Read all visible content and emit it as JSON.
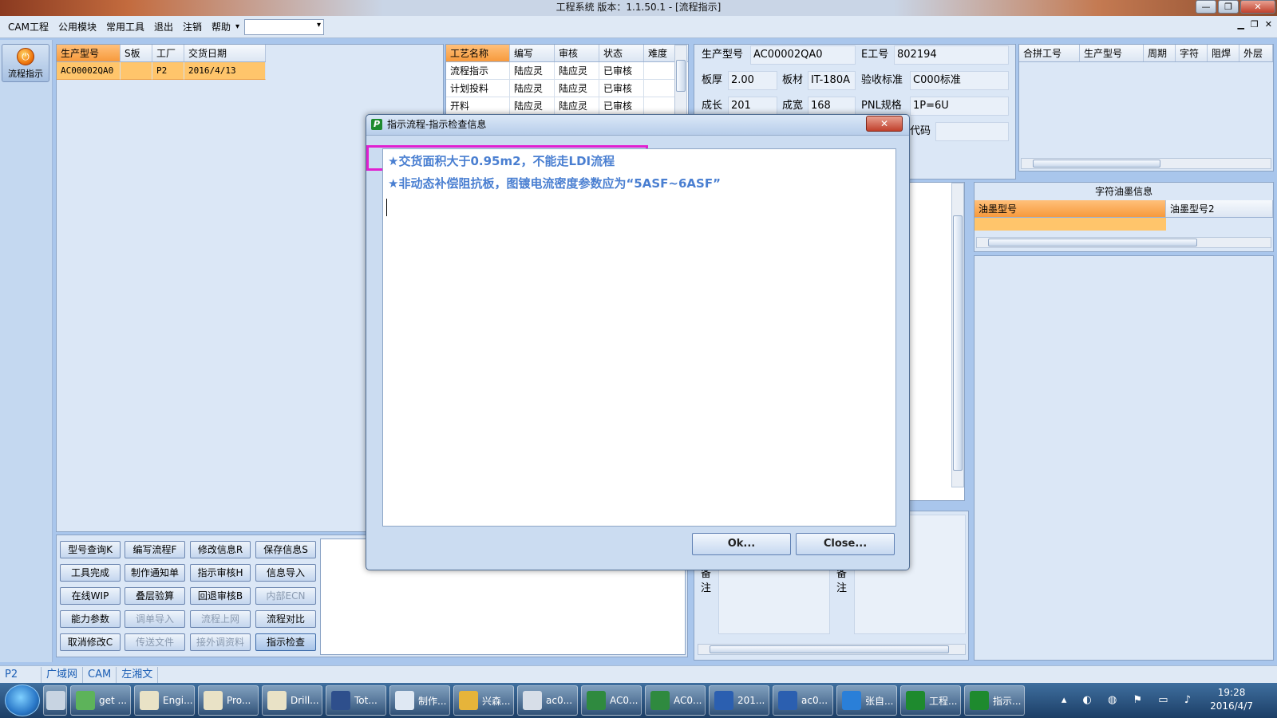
{
  "window": {
    "title": "工程系统    版本：1.1.50.1 - [流程指示]",
    "minimize": "—",
    "maximize": "❐",
    "close": "✕"
  },
  "menu": {
    "items": [
      "CAM工程",
      "公用模块",
      "常用工具",
      "退出",
      "注销",
      "帮助"
    ],
    "combo_value": ""
  },
  "launcher": {
    "label": "流程指示"
  },
  "model_grid": {
    "headers": [
      "生产型号",
      "S板",
      "工厂",
      "交货日期"
    ],
    "rows": [
      [
        "AC00002QA0",
        "",
        "P2",
        "2016/4/13"
      ]
    ]
  },
  "process_grid": {
    "headers": [
      "工艺名称",
      "编写",
      "审核",
      "状态",
      "难度"
    ],
    "rows": [
      [
        "流程指示",
        "陆应灵",
        "陆应灵",
        "已审核",
        ""
      ],
      [
        "计划投料",
        "陆应灵",
        "陆应灵",
        "已审核",
        ""
      ],
      [
        "开料",
        "陆应灵",
        "陆应灵",
        "已审核",
        ""
      ]
    ]
  },
  "info": {
    "model_label": "生产型号",
    "model_value": "AC00002QA0",
    "e_label": "E工号",
    "e_value": "802194",
    "thick_label": "板厚",
    "thick_value": "2.00",
    "material_label": "板材",
    "material_value": "IT-180A",
    "accept_label": "验收标准",
    "accept_value": "C000标准",
    "len_label": "成长",
    "len_value": "201",
    "width_label": "成宽",
    "width_value": "168",
    "pnl_label": "PNL规格",
    "pnl_value": "1P=6U",
    "code_label": "代码",
    "code_value": ""
  },
  "combine_grid": {
    "headers": [
      "合拼工号",
      "生产型号",
      "周期",
      "字符",
      "阻焊",
      "外层"
    ]
  },
  "ink_panel": {
    "title": "字符油墨信息",
    "headers": [
      "油墨型号",
      "油墨型号2"
    ]
  },
  "remarks": {
    "label1": "备注",
    "label2": "备注"
  },
  "buttons": [
    [
      "型号查询K",
      "编写流程F",
      "修改信息R",
      "保存信息S"
    ],
    [
      "工具完成",
      "制作通知单",
      "指示审核H",
      "信息导入"
    ],
    [
      "在线WIP",
      "叠层验算",
      "回退审核B",
      "内部ECN"
    ],
    [
      "能力参数",
      "调单导入",
      "流程上网",
      "流程对比"
    ],
    [
      "取消修改C",
      "传送文件",
      "接外调资料",
      "指示检查"
    ]
  ],
  "status": {
    "factory": "P2",
    "net": "广域网",
    "module": "CAM",
    "user": "左湘文"
  },
  "taskbar": {
    "items": [
      "get ...",
      "Engi...",
      "Pro...",
      "Drill...",
      "Tot...",
      "制作...",
      "兴森...",
      "ac0...",
      "AC0...",
      "AC0...",
      "201...",
      "ac0...",
      "张自...",
      "工程...",
      "指示..."
    ],
    "time": "19:28",
    "date": "2016/4/7"
  },
  "dialog": {
    "title": "指示流程-指示检查信息",
    "close": "✕",
    "messages": [
      "★交货面积大于0.95m2，不能走LDI流程",
      "★非动态补偿阻抗板，图镀电流密度参数应为“5ASF~6ASF”"
    ],
    "ok": "Ok...",
    "cancel": "Close..."
  },
  "colors": {
    "highlight_border": "#e020d0",
    "message_text": "#4a7fd1",
    "selected_row": "#ffc56b"
  }
}
